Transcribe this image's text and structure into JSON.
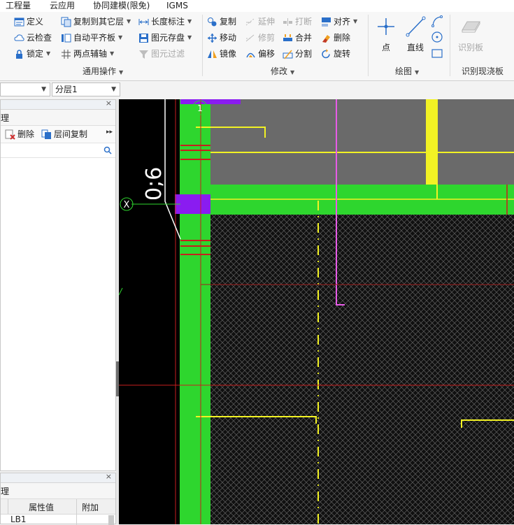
{
  "menu": [
    "工程量",
    "云应用",
    "协同建模(限免)",
    "IGMS"
  ],
  "ribbon": {
    "general": {
      "title": "通用操作",
      "define": "定义",
      "cloud_check": "云检查",
      "lock": "锁定",
      "copy_to_layer": "复制到其它层",
      "auto_flat_slab": "自动平齐板",
      "two_point_axis": "两点辅轴",
      "length_mark": "长度标注",
      "save_element": "图元存盘",
      "element_filter": "图元过滤"
    },
    "modify": {
      "title": "修改",
      "copy": "复制",
      "extend": "延伸",
      "break": "打断",
      "align": "对齐",
      "move": "移动",
      "trim": "修剪",
      "merge": "合并",
      "delete": "删除",
      "mirror": "镜像",
      "offset": "偏移",
      "split": "分割",
      "rotate": "旋转"
    },
    "draw": {
      "title": "绘图",
      "point": "点",
      "line": "直线"
    },
    "identify": {
      "title": "识别现浇板",
      "identify_slab": "识别板"
    }
  },
  "toolbar": {
    "combo2_value": "分层1"
  },
  "left_panel": {
    "tab_char": "理",
    "delete": "删除",
    "copy_between_layers": "层间复制",
    "more": "▸▸"
  },
  "props_panel": {
    "tab_char": "理",
    "col_value": "属性值",
    "col_extra": "附加",
    "row1_value": "LB1"
  },
  "canvas": {
    "dim_text": "0;6",
    "axis_x": "X",
    "axis_1": "1"
  },
  "colors": {
    "green": "#2ed62e",
    "yellow": "#f2f224",
    "magenta": "#e85ce8",
    "purple": "#8a1cf0",
    "grey": "#6a6a6a",
    "red": "#c81e1e"
  }
}
